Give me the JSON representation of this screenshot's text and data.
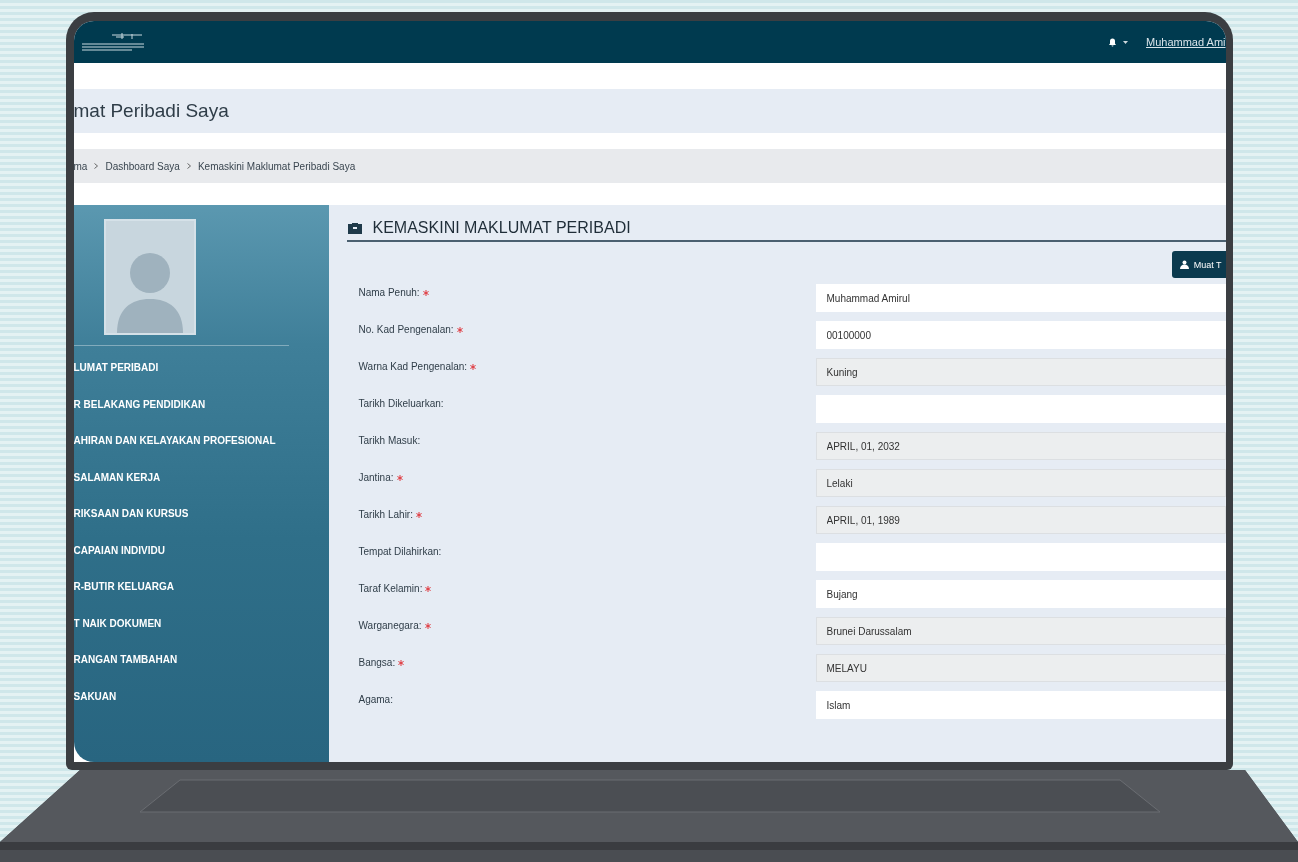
{
  "header": {
    "user_link": "Muhammad Ami"
  },
  "page_title": "mat Peribadi Saya",
  "breadcrumb": [
    "ma",
    "Dashboard Saya",
    "Kemaskini Maklumat Peribadi Saya"
  ],
  "sidebar": {
    "items": [
      {
        "label": "LUMAT PERIBADI"
      },
      {
        "label": "R BELAKANG PENDIDIKAN"
      },
      {
        "label": "AHIRAN DAN KELAYAKAN PROFESIONAL"
      },
      {
        "label": "SALAMAN KERJA"
      },
      {
        "label": "RIKSAAN DAN KURSUS"
      },
      {
        "label": "CAPAIAN INDIVIDU"
      },
      {
        "label": "R-BUTIR KELUARGA"
      },
      {
        "label": "T NAIK DOKUMEN"
      },
      {
        "label": "RANGAN TAMBAHAN"
      },
      {
        "label": "SAKUAN"
      }
    ]
  },
  "form": {
    "title": "KEMASKINI MAKLUMAT PERIBADI",
    "button": "Muat T",
    "fields": [
      {
        "label": "Nama Penuh:",
        "required": true,
        "disabled": false,
        "value": "Muhammad Amirul"
      },
      {
        "label": "No. Kad Pengenalan:",
        "required": true,
        "disabled": false,
        "value": "00100000"
      },
      {
        "label": "Warna Kad Pengenalan:",
        "required": true,
        "disabled": true,
        "value": "Kuning"
      },
      {
        "label": "Tarikh Dikeluarkan:",
        "required": false,
        "disabled": false
      },
      {
        "label": "Tarikh Masuk:",
        "required": false,
        "disabled": true,
        "value": "APRIL, 01, 2032"
      },
      {
        "label": "Jantina:",
        "required": true,
        "disabled": true,
        "value": "Lelaki"
      },
      {
        "label": "Tarikh Lahir:",
        "required": true,
        "disabled": true,
        "value": "APRIL, 01, 1989"
      },
      {
        "label": "Tempat Dilahirkan:",
        "required": false,
        "disabled": false
      },
      {
        "label": "Taraf Kelamin:",
        "required": true,
        "disabled": false,
        "value": "Bujang"
      },
      {
        "label": "Warganegara:",
        "required": true,
        "disabled": true,
        "value": "Brunei Darussalam"
      },
      {
        "label": "Bangsa:",
        "required": true,
        "disabled": true,
        "value": "MELAYU"
      },
      {
        "label": "Agama:",
        "required": false,
        "disabled": false,
        "value": "Islam"
      }
    ]
  }
}
